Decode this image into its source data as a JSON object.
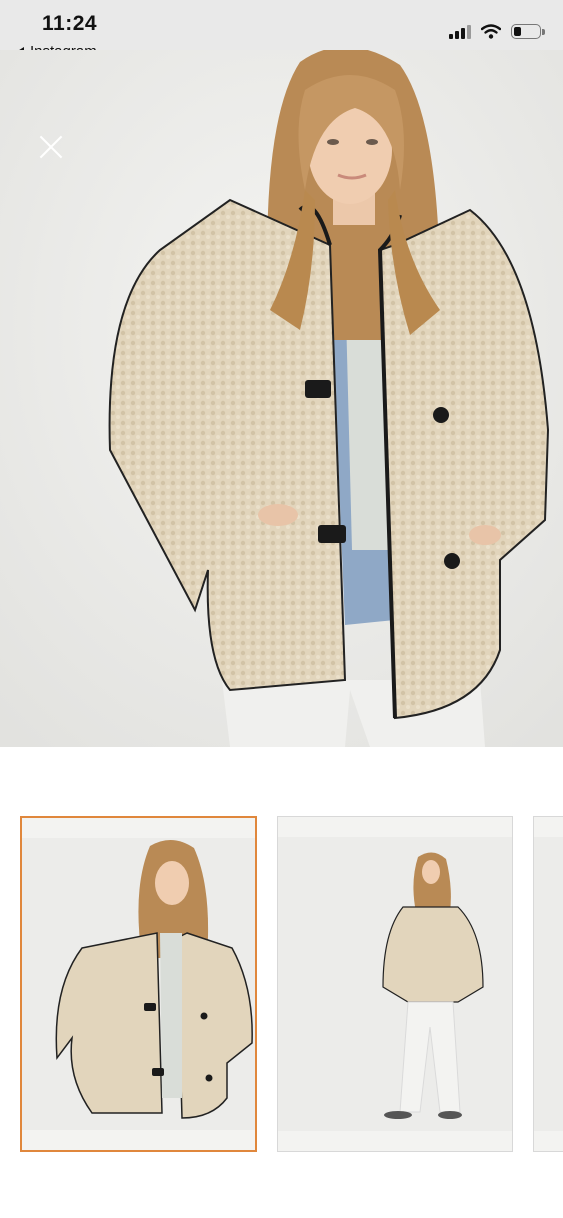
{
  "status_bar": {
    "time": "11:24",
    "back_app_label": "Instagram",
    "icons": [
      "cellular-signal-icon",
      "wifi-icon",
      "battery-icon"
    ]
  },
  "viewer": {
    "close_icon": "close-icon",
    "main_image": "model-wearing-cream-teddy-fleece-jacket-front",
    "thumbnails": [
      {
        "image": "model-jacket-front-closeup",
        "selected": true
      },
      {
        "image": "model-jacket-full-length",
        "selected": false
      },
      {
        "image": "partial-thumbnail",
        "selected": false
      }
    ]
  },
  "colors": {
    "accent_selected_border": "#e0873c",
    "jacket": "#e3d6bd",
    "background": "#ececea"
  }
}
